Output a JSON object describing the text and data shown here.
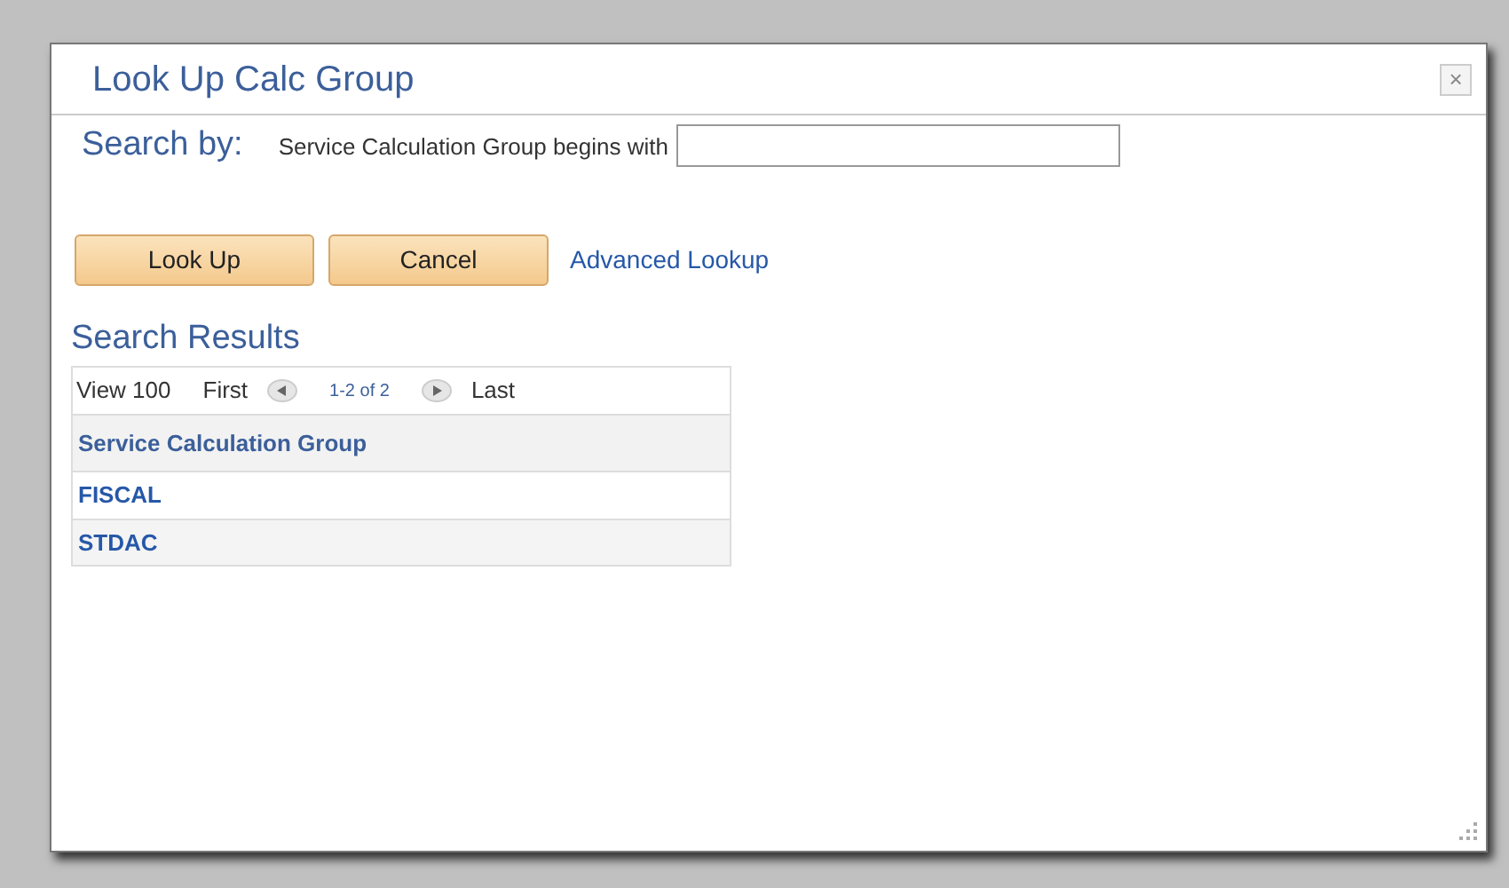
{
  "dialog": {
    "title": "Look Up Calc Group",
    "close": "×"
  },
  "search": {
    "label": "Search by:",
    "field_label": "Service Calculation Group begins with"
  },
  "buttons": [
    "Look Up",
    "Cancel"
  ],
  "advanced_link": "Advanced Lookup",
  "results": {
    "title": "Search Results",
    "nav": {
      "view": "View 100",
      "first": "First",
      "range": "1-2 of 2",
      "last": "Last"
    },
    "column": "Service Calculation Group",
    "rows": [
      "FISCAL",
      "STDAC"
    ]
  }
}
